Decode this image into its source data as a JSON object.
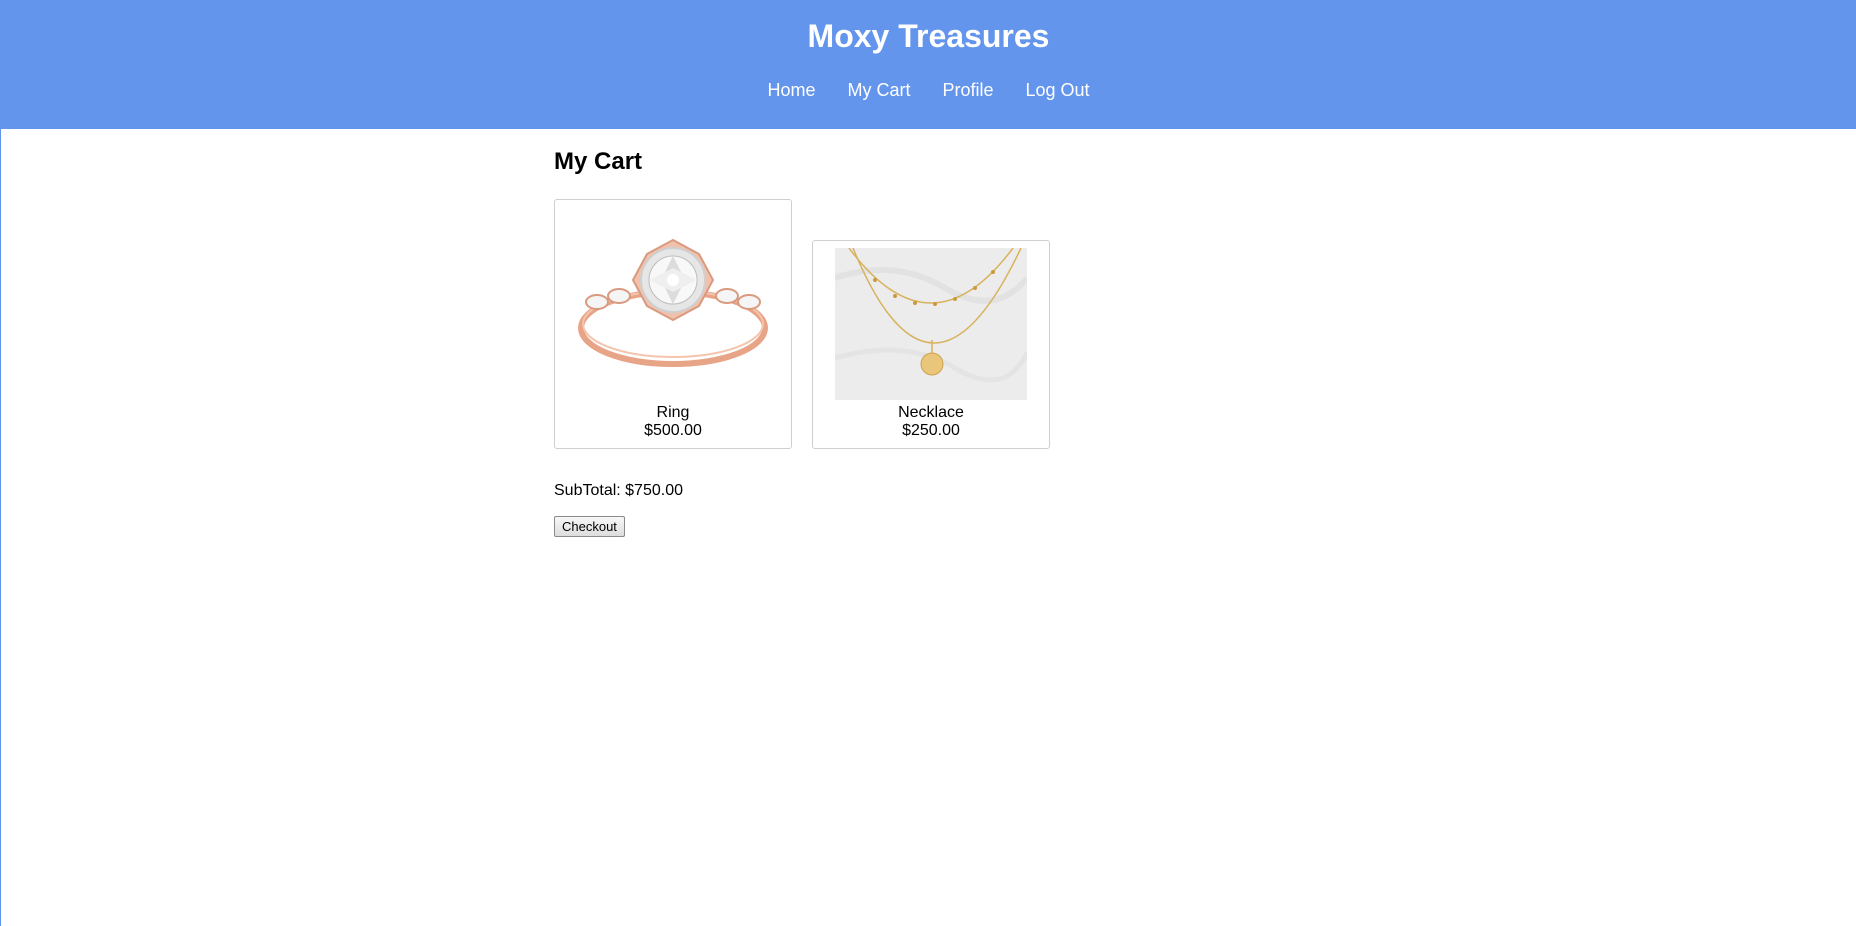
{
  "header": {
    "title": "Moxy Treasures",
    "nav": [
      {
        "label": "Home"
      },
      {
        "label": "My Cart"
      },
      {
        "label": "Profile"
      },
      {
        "label": "Log Out"
      }
    ],
    "background_color": "#6495ed"
  },
  "cart": {
    "heading": "My Cart",
    "items": [
      {
        "name": "Ring",
        "price": "$500.00",
        "image": "ring-image"
      },
      {
        "name": "Necklace",
        "price": "$250.00",
        "image": "necklace-image"
      }
    ],
    "subtotal": "SubTotal: $750.00",
    "checkout_label": "Checkout"
  }
}
